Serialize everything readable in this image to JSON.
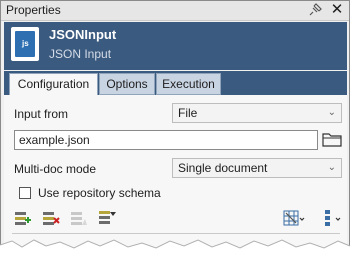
{
  "window": {
    "title": "Properties"
  },
  "header": {
    "name": "JSONInput",
    "type": "JSON Input",
    "icon_text": "js"
  },
  "tabs": [
    {
      "label": "Configuration",
      "active": true
    },
    {
      "label": "Options",
      "active": false
    },
    {
      "label": "Execution",
      "active": false
    }
  ],
  "form": {
    "input_from_label": "Input from",
    "input_from_value": "File",
    "file_value": "example.json",
    "multidoc_label": "Multi-doc mode",
    "multidoc_value": "Single document",
    "repo_schema_label": "Use repository schema",
    "repo_schema_checked": false
  },
  "icons": {
    "add_row": "add-row-icon",
    "delete_row": "delete-row-icon",
    "clear_rows": "clear-rows-icon",
    "filter_rows": "filter-rows-icon",
    "grid_view": "grid-view-icon",
    "column_settings": "column-settings-icon"
  },
  "colors": {
    "header_bg": "#3b5a7f",
    "accent_blue": "#2d6fb1"
  }
}
